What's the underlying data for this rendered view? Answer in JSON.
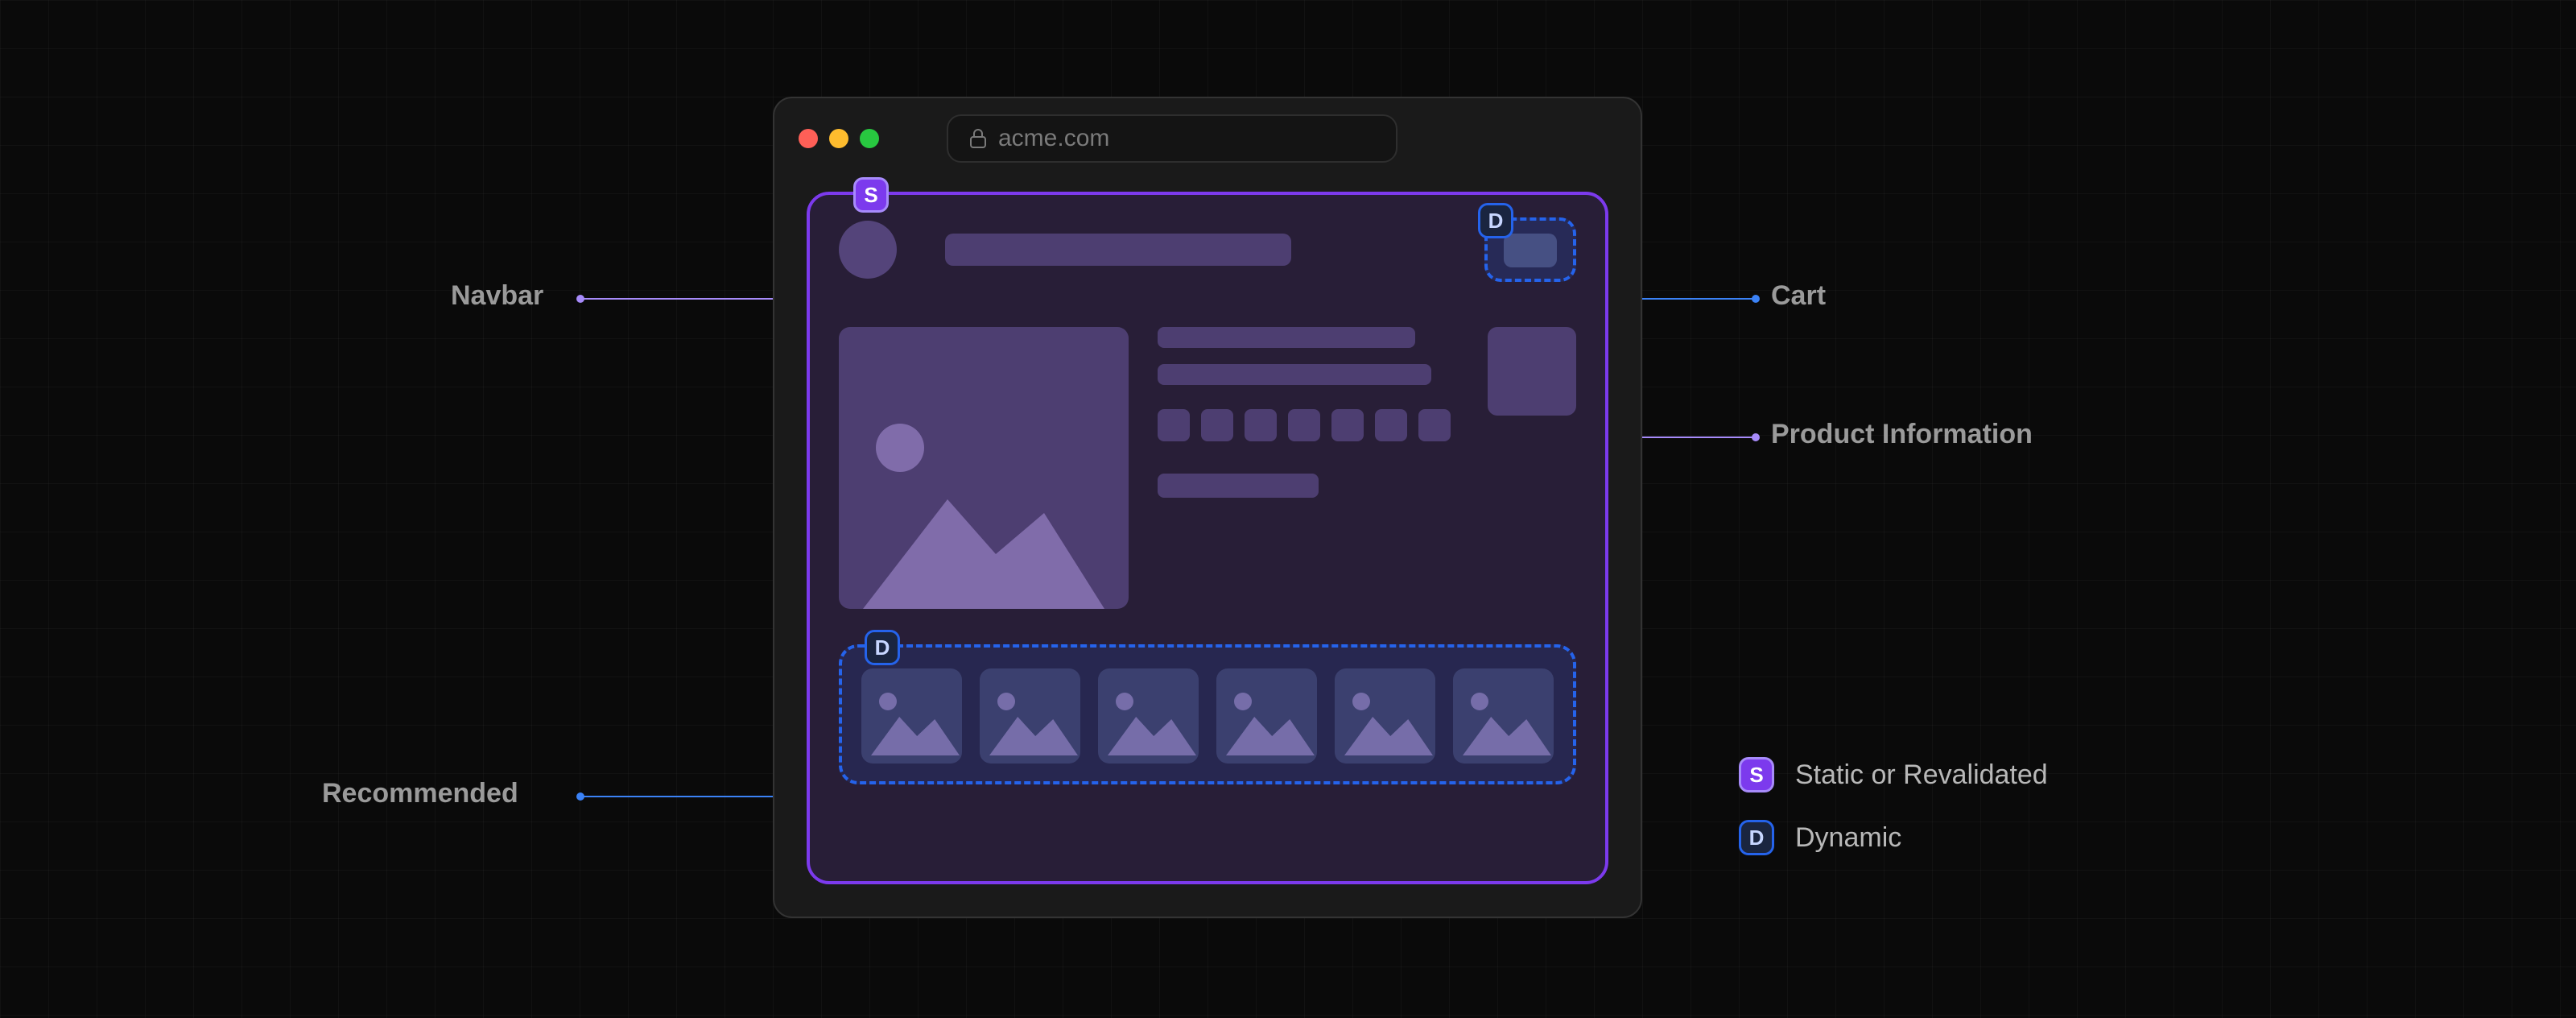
{
  "browser": {
    "url": "acme.com"
  },
  "annotations": {
    "navbar": "Navbar",
    "cart": "Cart",
    "product_info": "Product Information",
    "recommended": "Recommended"
  },
  "badges": {
    "static": "S",
    "dynamic": "D"
  },
  "legend": {
    "static": "Static or Revalidated",
    "dynamic": "Dynamic"
  },
  "colors": {
    "static": "#7c3aed",
    "dynamic": "#2563eb"
  },
  "recommended_count": 6,
  "swatch_count": 7
}
